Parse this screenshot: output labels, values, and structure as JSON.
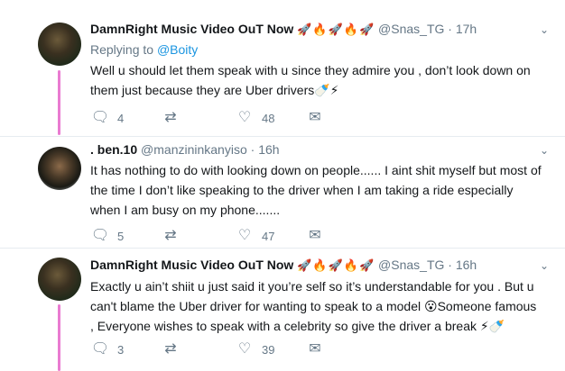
{
  "tweets": [
    {
      "name": "DamnRight Music Video OuT Now",
      "emojis": "🚀🔥🚀🔥🚀",
      "handle": "@Snas_TG",
      "time": "· 17h",
      "replying_prefix": "Replying to",
      "replying_to": "@Boity",
      "text": "Well u should let them speak with u since they admire you , don’t look down on them just because they are Uber drivers🍼⚡",
      "replies": "4",
      "retweets": "",
      "likes": "48"
    },
    {
      "name": ". ben.10",
      "emojis": "",
      "handle": "@manzininkanyiso",
      "time": "· 16h",
      "text": "It has nothing to do with looking down on people...... I aint shit myself but most of the time I don’t like speaking to the driver when I am taking a ride especially when I am busy on my phone.......",
      "replies": "5",
      "retweets": "",
      "likes": "47"
    },
    {
      "name": "DamnRight Music Video OuT Now",
      "emojis": "🚀🔥🚀🔥🚀",
      "handle": "@Snas_TG",
      "time": "· 16h",
      "text": "Exactly u ain’t shiit u just said it you’re self so it’s understandable for you . But u can't blame the Uber driver for wanting to speak to a model 😮Someone famous , Everyone wishes to speak with a celebrity so give the driver a break ⚡🍼",
      "replies": "3",
      "retweets": "",
      "likes": "39"
    }
  ],
  "icons": {
    "reply": "reply-icon",
    "retweet": "retweet-icon",
    "like": "heart-icon",
    "dm": "envelope-icon",
    "caret": "chevron-down-icon"
  },
  "colors": {
    "thread_line": "#e97bd1",
    "link": "#1b95e0",
    "muted": "#657786"
  }
}
